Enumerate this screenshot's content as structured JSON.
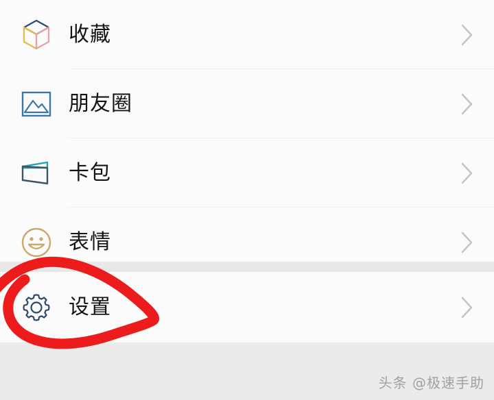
{
  "app": {
    "screen_name": "me-tab-list",
    "background_color": "#ebebeb",
    "card_color": "#fbfbfb"
  },
  "list": {
    "groups": [
      {
        "name": "main-group",
        "items": [
          {
            "label": "收藏",
            "icon": "cube-icon",
            "icon_colors": [
              "#2d4a73",
              "#e8b84b",
              "#e8a0a8"
            ],
            "chevron": "chevron-right-icon"
          },
          {
            "label": "朋友圈",
            "icon": "photo-icon",
            "icon_colors": [
              "#3b76a8"
            ],
            "chevron": "chevron-right-icon"
          },
          {
            "label": "卡包",
            "icon": "card-wallet-icon",
            "icon_colors": [
              "#1aa6ae",
              "#3d5566"
            ],
            "chevron": "chevron-right-icon"
          },
          {
            "label": "表情",
            "icon": "smiley-icon",
            "icon_colors": [
              "#c9a96a"
            ],
            "chevron": "chevron-right-icon"
          }
        ]
      },
      {
        "name": "settings-group",
        "items": [
          {
            "label": "设置",
            "icon": "gear-icon",
            "icon_colors": [
              "#2d4a6b"
            ],
            "chevron": "chevron-right-icon"
          }
        ]
      }
    ]
  },
  "annotation": {
    "name": "red-circle-highlight",
    "color": "#ec1c1c",
    "target_label": "设置"
  },
  "watermark": {
    "text": "头条 @极速手助",
    "color": "#9a9a9a"
  }
}
